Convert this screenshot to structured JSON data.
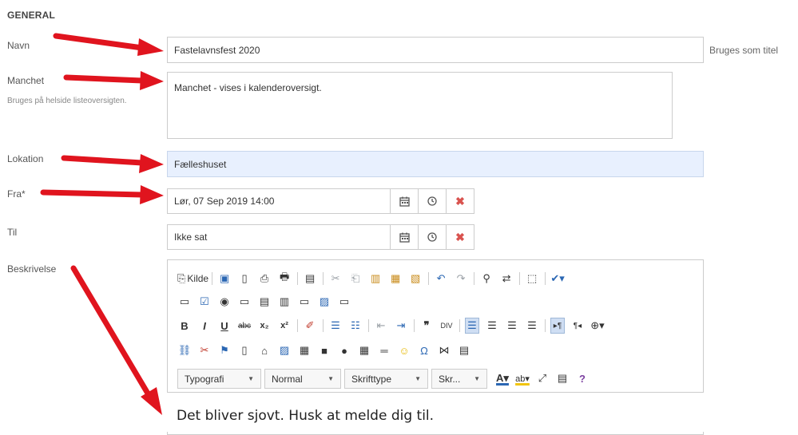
{
  "section": {
    "title": "GENERAL"
  },
  "fields": {
    "navn": {
      "label": "Navn",
      "value": "Fastelavnsfest 2020",
      "side_note": "Bruges som titel"
    },
    "manchet": {
      "label": "Manchet",
      "hint": "Bruges på helside listeoversigten.",
      "value": "Manchet - vises i kalenderoversigt."
    },
    "lokation": {
      "label": "Lokation",
      "value": "Fælleshuset"
    },
    "fra": {
      "label": "Fra*",
      "value": "Lør, 07 Sep 2019 14:00"
    },
    "til": {
      "label": "Til",
      "value": "Ikke sat"
    },
    "beskrivelse": {
      "label": "Beskrivelse"
    }
  },
  "datetime_buttons": {
    "calendar_icon": "calendar-icon",
    "clock_icon": "clock-icon",
    "clear_icon": "clear-icon"
  },
  "editor": {
    "source_label": "Kilde",
    "combos": {
      "format": "Typografi",
      "style": "Normal",
      "font": "Skrifttype",
      "size": "Skr..."
    },
    "content": "Det bliver sjovt. Husk at melde dig til."
  },
  "colors": {
    "accent_blue": "#2b67b3",
    "highlight_field": "#e8f0fe",
    "arrow_red": "#e0141e",
    "clear_red": "#d9534f"
  }
}
